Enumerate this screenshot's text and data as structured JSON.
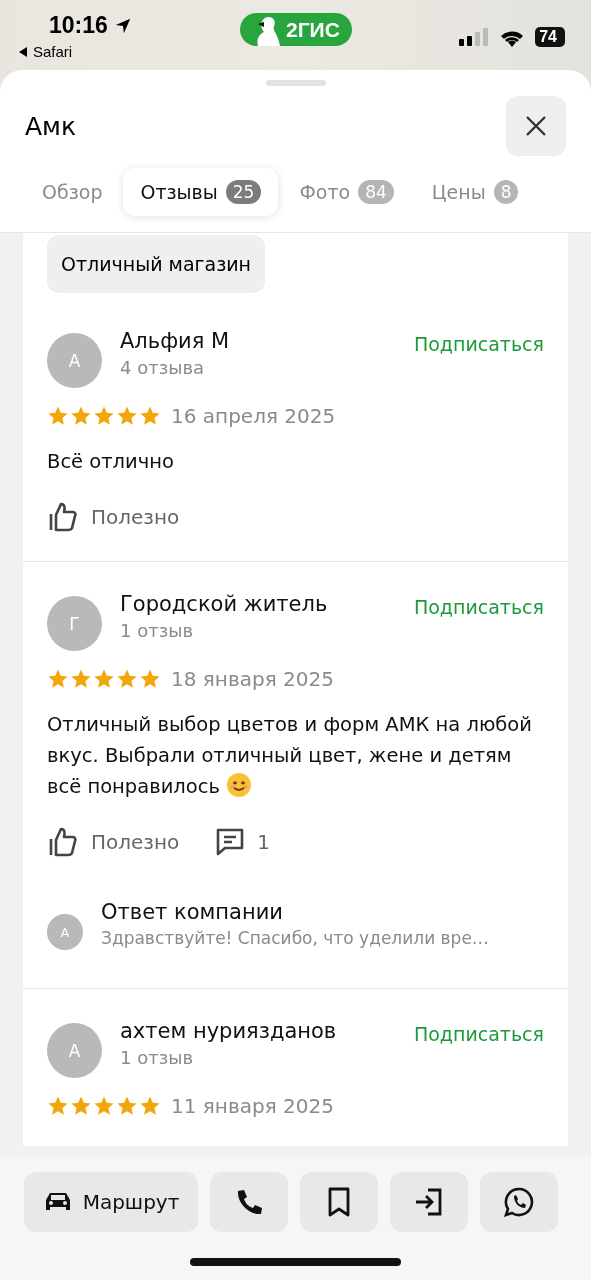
{
  "status_bar": {
    "time": "10:16",
    "back_app": "Safari",
    "logo": "2ГИС",
    "battery": "74"
  },
  "header": {
    "title": "Амк"
  },
  "tabs": [
    {
      "label": "Обзор",
      "selected": false
    },
    {
      "label": "Отзывы",
      "count": "25",
      "selected": true
    },
    {
      "label": "Фото",
      "count": "84",
      "selected": false
    },
    {
      "label": "Цены",
      "count": "8",
      "selected": false
    }
  ],
  "tag": "Отличный магазин",
  "reviews": [
    {
      "avatar": "А",
      "name": "Альфия М",
      "review_count": "4 отзыва",
      "subscribe": "Подписаться",
      "stars": 5,
      "date": "16 апреля 2025",
      "text": "Всё отлично",
      "useful": "Полезно"
    },
    {
      "avatar": "Г",
      "name": "Городской житель",
      "review_count": "1 отзыв",
      "subscribe": "Подписаться",
      "stars": 5,
      "date": "18 января 2025",
      "text": "Отличный выбор цветов и форм АМК на любой вкус. Выбрали отличный цвет, жене и детям всё понравилось",
      "smiley": true,
      "useful": "Полезно",
      "comments": "1",
      "reply": {
        "avatar": "А",
        "title": "Ответ компании",
        "text": "Здравствуйте! Спасибо, что уделили вре…"
      }
    },
    {
      "avatar": "А",
      "name": "ахтем нуриязданов",
      "review_count": "1 отзыв",
      "subscribe": "Подписаться",
      "stars": 5,
      "date": "11 января 2025"
    }
  ],
  "action_bar": [
    {
      "kind": "route",
      "label": "Маршрут"
    },
    {
      "kind": "phone"
    },
    {
      "kind": "bookmark"
    },
    {
      "kind": "enter"
    },
    {
      "kind": "whatsapp"
    }
  ]
}
